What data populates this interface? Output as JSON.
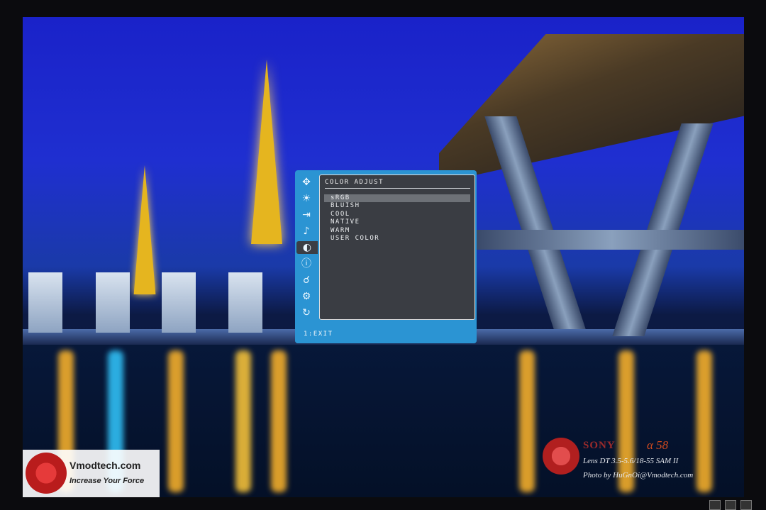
{
  "osd": {
    "title": "COLOR ADJUST",
    "items": [
      {
        "label": "sRGB",
        "selected": true
      },
      {
        "label": "BLUISH",
        "selected": false
      },
      {
        "label": "COOL",
        "selected": false
      },
      {
        "label": "NATIVE",
        "selected": false
      },
      {
        "label": "WARM",
        "selected": false
      },
      {
        "label": "USER COLOR",
        "selected": false
      }
    ],
    "footer": "1:EXIT",
    "sidebar_icons": [
      "auto-adjust-icon",
      "brightness-icon",
      "input-select-icon",
      "audio-icon",
      "color-adjust-icon",
      "information-icon",
      "manual-image-adjust-icon",
      "setup-menu-icon",
      "memory-recall-icon"
    ],
    "active_icon": "color-adjust-icon",
    "colors": {
      "frame": "#2b94d3",
      "panel": "#3a3d43",
      "selected": "#6d7177"
    }
  },
  "watermark_left": {
    "site": "Vmodtech.com",
    "tagline": "Increase Your Force"
  },
  "watermark_right": {
    "brand": "SONY",
    "model": "α 58",
    "lens": "Lens DT 3.5-5.6/18-55 SAM II",
    "photo": "Photo by HuGnOi@Vmodtech.com"
  }
}
